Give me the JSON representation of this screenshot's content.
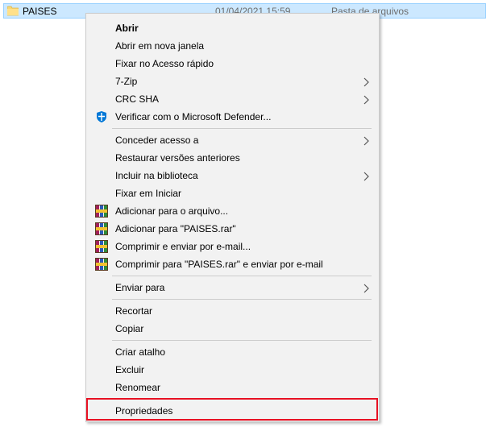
{
  "file_row": {
    "name": "PAISES",
    "date": "01/04/2021 15:59",
    "type": "Pasta de arquivos",
    "icon": "folder-icon"
  },
  "menu": {
    "items": [
      {
        "label": "Abrir",
        "bold": true
      },
      {
        "label": "Abrir em nova janela"
      },
      {
        "label": "Fixar no Acesso rápido"
      },
      {
        "label": "7-Zip",
        "submenu": true
      },
      {
        "label": "CRC SHA",
        "submenu": true
      },
      {
        "label": "Verificar com o Microsoft Defender...",
        "icon": "defender-shield-icon"
      },
      {
        "label": "Conceder acesso a",
        "submenu": true
      },
      {
        "label": "Restaurar versões anteriores"
      },
      {
        "label": "Incluir na biblioteca",
        "submenu": true
      },
      {
        "label": "Fixar em Iniciar"
      },
      {
        "label": "Adicionar para o arquivo...",
        "icon": "winrar-icon"
      },
      {
        "label": "Adicionar para \"PAISES.rar\"",
        "icon": "winrar-icon"
      },
      {
        "label": "Comprimir e enviar por e-mail...",
        "icon": "winrar-icon"
      },
      {
        "label": "Comprimir para \"PAISES.rar\" e enviar por e-mail",
        "icon": "winrar-icon"
      },
      {
        "label": "Enviar para",
        "submenu": true
      },
      {
        "label": "Recortar"
      },
      {
        "label": "Copiar"
      },
      {
        "label": "Criar atalho"
      },
      {
        "label": "Excluir"
      },
      {
        "label": "Renomear"
      },
      {
        "label": "Propriedades"
      }
    ]
  },
  "colors": {
    "selection": "#cce8ff",
    "menu_background": "#f2f2f2",
    "highlight_border": "#e81123",
    "defender_blue": "#0078d7"
  }
}
